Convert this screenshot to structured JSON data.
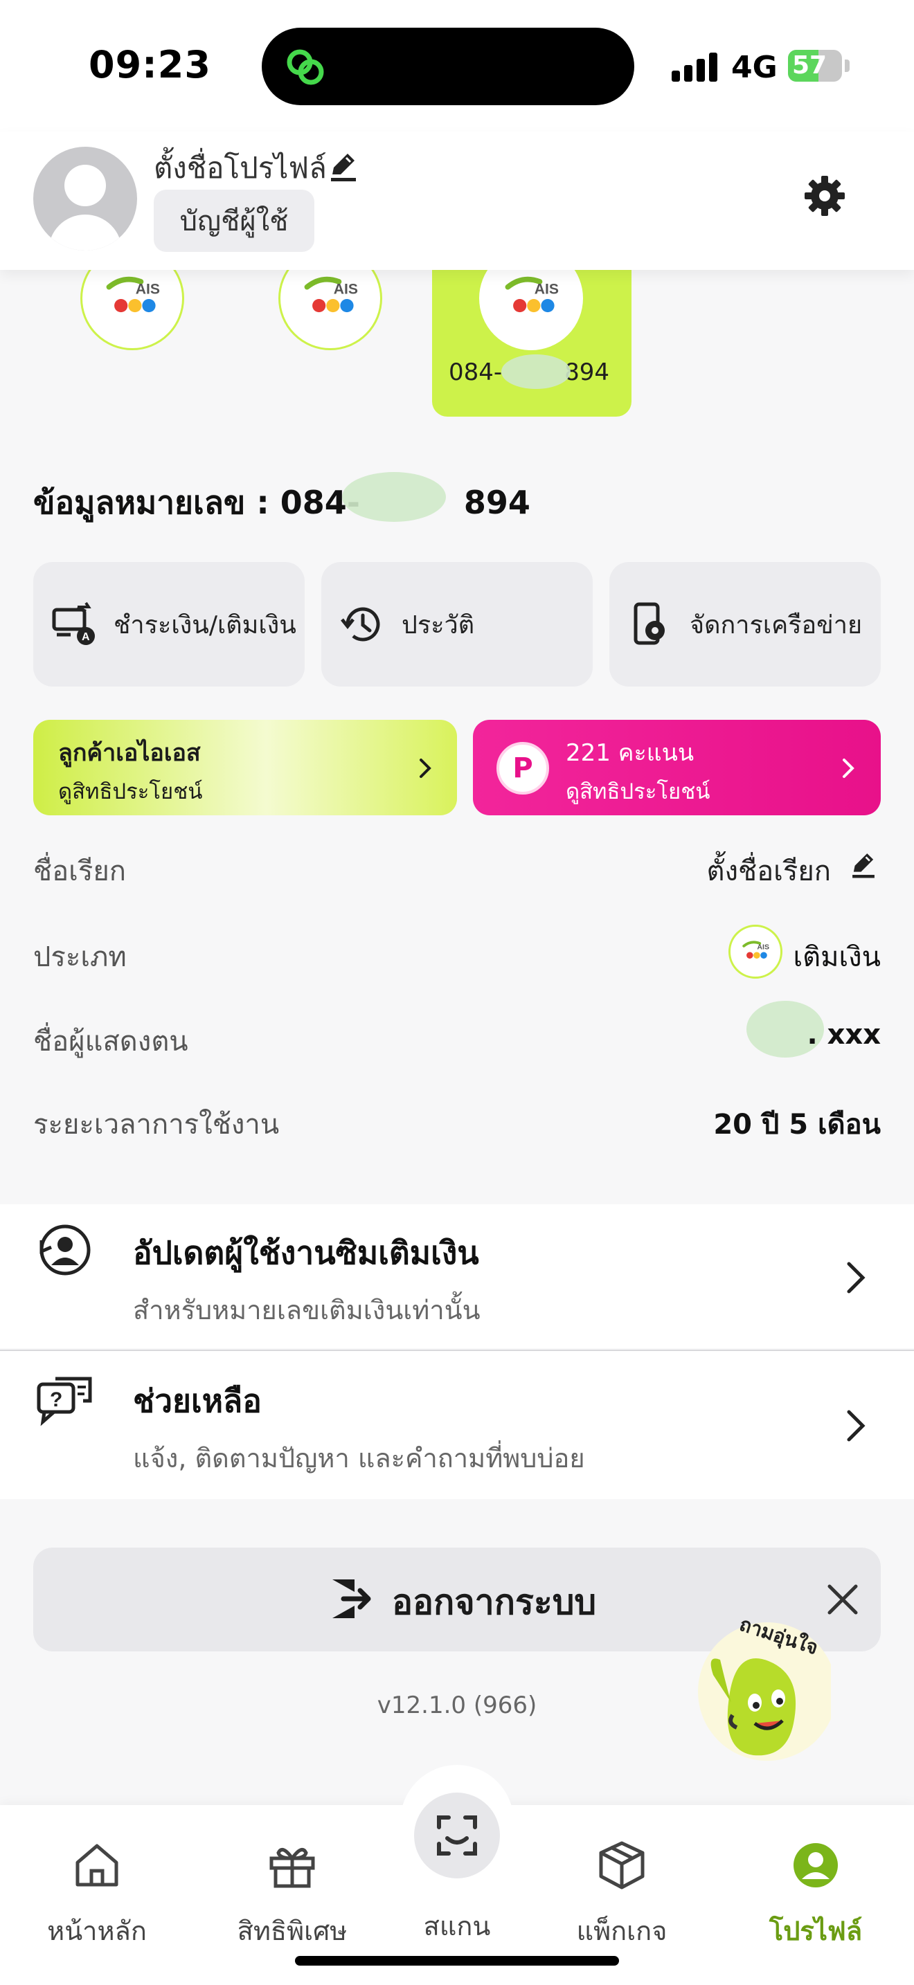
{
  "status_bar": {
    "time": "09:23",
    "network": "4G",
    "battery_level": "57",
    "battery_percent": 57,
    "icons": [
      "signal-icon",
      "battery-charging-icon",
      "app-link-icon"
    ]
  },
  "profile": {
    "name": "ตั้งชื่อโปรไฟล์",
    "account_button": "บัญชีผู้ใช้"
  },
  "sim_cards": [
    {
      "number": "",
      "active": false,
      "brand": "AIS"
    },
    {
      "number": "",
      "active": false,
      "brand": "AIS"
    },
    {
      "number": "084-xxx894",
      "number_prefix": "084-",
      "number_suffix": "894",
      "active": true,
      "brand": "AIS"
    }
  ],
  "number_info": {
    "title_prefix": "ข้อมูลหมายเลข : 084-",
    "title_suffix": "894"
  },
  "actions": [
    {
      "label": "ชำระเงิน/เติมเงิน",
      "icon": "payment-topup-icon"
    },
    {
      "label": "ประวัติ",
      "icon": "history-icon"
    },
    {
      "label": "จัดการเครือข่าย",
      "icon": "network-settings-icon"
    }
  ],
  "banners": {
    "ais": {
      "title": "ลูกค้าเอไอเอส",
      "subtitle": "ดูสิทธิประโยชน์",
      "color": "#cdf24a"
    },
    "points": {
      "badge": "P",
      "title": "221 คะแนน",
      "subtitle": "ดูสิทธิประโยชน์",
      "color": "#e8118a"
    }
  },
  "details": [
    {
      "label": "ชื่อเรียก",
      "value": "ตั้งชื่อเรียก"
    },
    {
      "label": "ประเภท",
      "value": "เติมเงิน"
    },
    {
      "label": "ชื่อผู้แสดงตน",
      "value": ". xxx"
    },
    {
      "label": "ระยะเวลาการใช้งาน",
      "value": "20 ปี 5 เดือน"
    }
  ],
  "menu": [
    {
      "title": "อัปเดตผู้ใช้งานซิมเติมเงิน",
      "subtitle": "สำหรับหมายเลขเติมเงินเท่านั้น",
      "icon": "user-update-icon"
    },
    {
      "title": "ช่วยเหลือ",
      "subtitle": "แจ้ง, ติดตามปัญหา และคำถามที่พบบ่อย",
      "icon": "help-chat-icon"
    }
  ],
  "logout": {
    "label": "ออกจากระบบ"
  },
  "version": "v12.1.0 (966)",
  "mascot": {
    "caption": "ถามอุ่นใจ"
  },
  "bottom_nav": [
    {
      "label": "หน้าหลัก",
      "icon": "home-icon",
      "active": false
    },
    {
      "label": "สิทธิพิเศษ",
      "icon": "gift-icon",
      "active": false
    },
    {
      "label": "สแกน",
      "icon": "scan-icon",
      "active": false
    },
    {
      "label": "แพ็กเกจ",
      "icon": "package-icon",
      "active": false
    },
    {
      "label": "โปรไฟล์",
      "icon": "profile-icon",
      "active": true
    }
  ],
  "colors": {
    "accent": "#cdf24a",
    "active_nav": "#6a9c12",
    "points": "#e8118a"
  }
}
